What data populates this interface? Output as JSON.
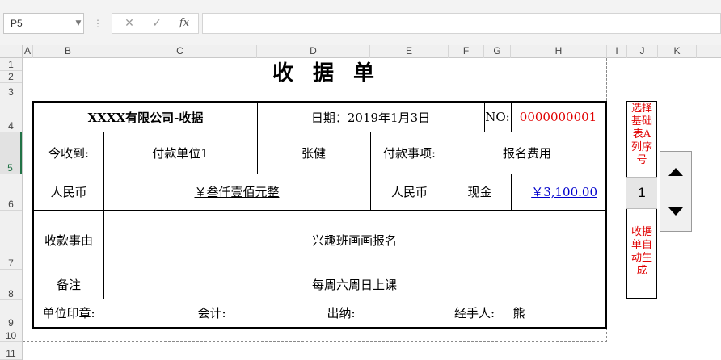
{
  "formula_bar": {
    "name_box": "P5",
    "cancel_glyph": "✕",
    "enter_glyph": "✓",
    "function_glyph": "fx",
    "formula": ""
  },
  "columns": [
    "A",
    "B",
    "C",
    "D",
    "E",
    "F",
    "G",
    "H",
    "I",
    "J",
    "K"
  ],
  "rows": [
    "1",
    "2",
    "3",
    "4",
    "5",
    "6",
    "7",
    "8",
    "9",
    "10",
    "11"
  ],
  "receipt": {
    "title": "收据单",
    "company": "XXXX有限公司-收据",
    "date": "日期：2019年1月3日",
    "no_label": "NO:",
    "no_value": "0000000001",
    "received_label": "今收到:",
    "payer_unit": "付款单位1",
    "payer_name": "张健",
    "payment_item_label": "付款事项:",
    "payment_item": "报名费用",
    "rmb_label": "人民币",
    "amount_words": "￥叁仟壹佰元整",
    "rmb_label2": "人民币",
    "pay_method": "现金",
    "amount": "￥3,100.00",
    "reason_label": "收款事由",
    "reason": "兴趣班画画报名",
    "remark_label": "备注",
    "remark": "每周六周日上课",
    "seal_label": "单位印章:",
    "accountant_label": "会计:",
    "cashier_label": "出纳:",
    "handler_label": "经手人:",
    "handler": "熊"
  },
  "side_panel": {
    "top_note": "选择基础表A列序号",
    "value": "1",
    "bottom_note": "收据单自动生成",
    "note_color": "#e00000"
  },
  "colors": {
    "red": "#e00000",
    "blue": "#0000cc",
    "excel_green": "#217346"
  }
}
